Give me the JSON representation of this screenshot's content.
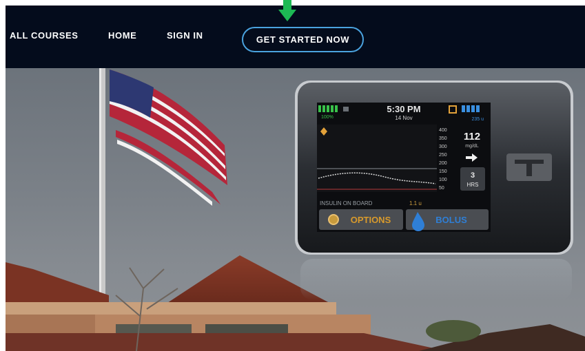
{
  "nav": {
    "links": [
      "ALL COURSES",
      "HOME",
      "SIGN IN"
    ],
    "cta_label": "GET STARTED NOW"
  },
  "colors": {
    "navbar_bg": "#040c1c",
    "cta_border": "#4aa3df",
    "pointer_arrow": "#1db954"
  },
  "device": {
    "time": "5:30 PM",
    "date": "14 Nov",
    "battery_pct": "100%",
    "insulin_units": "235 u",
    "cgm_value": "112",
    "cgm_unit": "mg/dL",
    "trend_icon": "arrow-right-icon",
    "range_value": "3",
    "range_unit": "HRS",
    "scale_labels": [
      "400",
      "350",
      "300",
      "250",
      "200",
      "150",
      "100",
      "50"
    ],
    "iob_label": "INSULIN ON BOARD",
    "iob_value": "1.1 u",
    "options_label": "OPTIONS",
    "bolus_label": "BOLUS"
  }
}
